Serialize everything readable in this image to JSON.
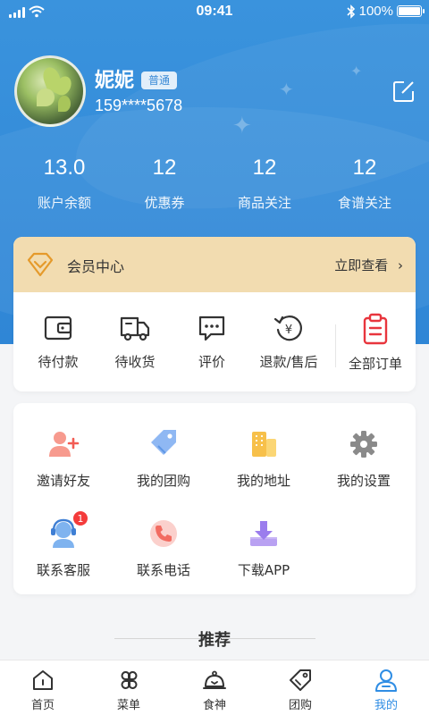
{
  "status_bar": {
    "time": "09:41",
    "battery": "100%"
  },
  "profile": {
    "name": "妮妮",
    "level_badge": "普通",
    "phone": "159****5678"
  },
  "stats": [
    {
      "value": "13.0",
      "label": "账户余额"
    },
    {
      "value": "12",
      "label": "优惠券"
    },
    {
      "value": "12",
      "label": "商品关注"
    },
    {
      "value": "12",
      "label": "食谱关注"
    }
  ],
  "vip": {
    "title": "会员中心",
    "link": "立即查看"
  },
  "orders": [
    {
      "label": "待付款",
      "icon": "wallet-icon"
    },
    {
      "label": "待收货",
      "icon": "truck-icon"
    },
    {
      "label": "评价",
      "icon": "comment-icon"
    },
    {
      "label": "退款/售后",
      "icon": "refund-icon"
    },
    {
      "label": "全部订单",
      "icon": "clipboard-icon"
    }
  ],
  "tools": [
    {
      "label": "邀请好友",
      "icon": "invite-friend-icon"
    },
    {
      "label": "我的团购",
      "icon": "group-buy-tag-icon"
    },
    {
      "label": "我的地址",
      "icon": "address-building-icon"
    },
    {
      "label": "我的设置",
      "icon": "gear-icon"
    },
    {
      "label": "联系客服",
      "icon": "customer-service-icon",
      "badge": "1"
    },
    {
      "label": "联系电话",
      "icon": "phone-icon"
    },
    {
      "label": "下载APP",
      "icon": "download-icon"
    }
  ],
  "recommend_title": "推荐",
  "tabs": [
    {
      "label": "首页",
      "icon": "home-icon"
    },
    {
      "label": "菜单",
      "icon": "menu-grid-icon"
    },
    {
      "label": "食神",
      "icon": "chef-cloche-icon"
    },
    {
      "label": "团购",
      "icon": "tag-icon"
    },
    {
      "label": "我的",
      "icon": "user-icon",
      "active": true
    }
  ],
  "colors": {
    "primary": "#2f86d6",
    "accent_tab": "#2f8de4",
    "vip_bg": "#f2dcb0",
    "order_highlight": "#e8353d",
    "badge": "#f43b3b"
  }
}
